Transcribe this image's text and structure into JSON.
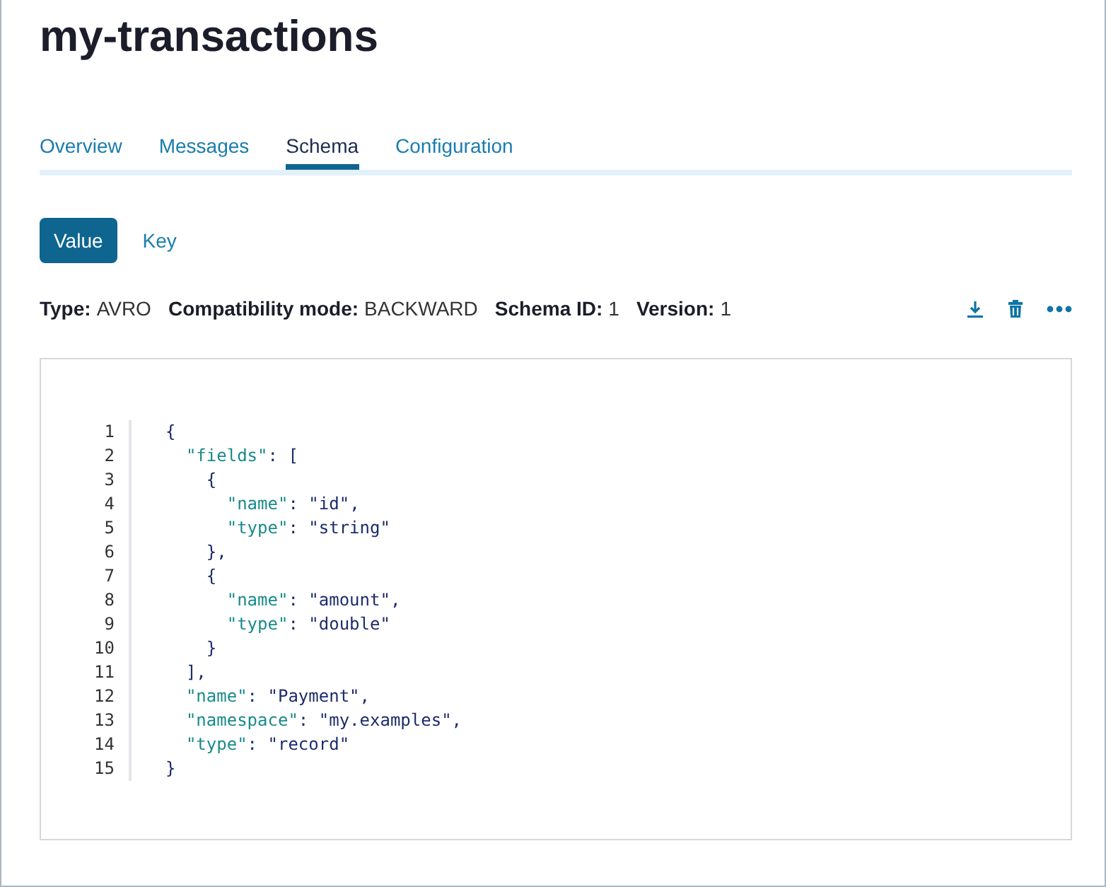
{
  "title": "my-transactions",
  "tabs": [
    {
      "label": "Overview",
      "selected": false
    },
    {
      "label": "Messages",
      "selected": false
    },
    {
      "label": "Schema",
      "selected": true
    },
    {
      "label": "Configuration",
      "selected": false
    }
  ],
  "toggle": [
    {
      "label": "Value",
      "selected": true
    },
    {
      "label": "Key",
      "selected": false
    }
  ],
  "meta": [
    {
      "label": "Type:",
      "value": "AVRO"
    },
    {
      "label": "Compatibility mode:",
      "value": "BACKWARD"
    },
    {
      "label": "Schema ID:",
      "value": "1"
    },
    {
      "label": "Version:",
      "value": "1"
    }
  ],
  "code_lines": [
    {
      "number": "1",
      "tokens": [
        {
          "kind": "punct",
          "text": "{"
        }
      ]
    },
    {
      "number": "2",
      "tokens": [
        {
          "kind": "key",
          "text": "  \"fields\""
        },
        {
          "kind": "punct",
          "text": ": ["
        }
      ]
    },
    {
      "number": "3",
      "tokens": [
        {
          "kind": "punct",
          "text": "    {"
        }
      ]
    },
    {
      "number": "4",
      "tokens": [
        {
          "kind": "key",
          "text": "      \"name\""
        },
        {
          "kind": "punct",
          "text": ": "
        },
        {
          "kind": "string",
          "text": "\"id\""
        },
        {
          "kind": "punct",
          "text": ","
        }
      ]
    },
    {
      "number": "5",
      "tokens": [
        {
          "kind": "key",
          "text": "      \"type\""
        },
        {
          "kind": "punct",
          "text": ": "
        },
        {
          "kind": "string",
          "text": "\"string\""
        }
      ]
    },
    {
      "number": "6",
      "tokens": [
        {
          "kind": "punct",
          "text": "    },"
        }
      ]
    },
    {
      "number": "7",
      "tokens": [
        {
          "kind": "punct",
          "text": "    {"
        }
      ]
    },
    {
      "number": "8",
      "tokens": [
        {
          "kind": "key",
          "text": "      \"name\""
        },
        {
          "kind": "punct",
          "text": ": "
        },
        {
          "kind": "string",
          "text": "\"amount\""
        },
        {
          "kind": "punct",
          "text": ","
        }
      ]
    },
    {
      "number": "9",
      "tokens": [
        {
          "kind": "key",
          "text": "      \"type\""
        },
        {
          "kind": "punct",
          "text": ": "
        },
        {
          "kind": "string",
          "text": "\"double\""
        }
      ]
    },
    {
      "number": "10",
      "tokens": [
        {
          "kind": "punct",
          "text": "    }"
        }
      ]
    },
    {
      "number": "11",
      "tokens": [
        {
          "kind": "punct",
          "text": "  ],"
        }
      ]
    },
    {
      "number": "12",
      "tokens": [
        {
          "kind": "key",
          "text": "  \"name\""
        },
        {
          "kind": "punct",
          "text": ": "
        },
        {
          "kind": "string",
          "text": "\"Payment\""
        },
        {
          "kind": "punct",
          "text": ","
        }
      ]
    },
    {
      "number": "13",
      "tokens": [
        {
          "kind": "key",
          "text": "  \"namespace\""
        },
        {
          "kind": "punct",
          "text": ": "
        },
        {
          "kind": "string",
          "text": "\"my.examples\""
        },
        {
          "kind": "punct",
          "text": ","
        }
      ]
    },
    {
      "number": "14",
      "tokens": [
        {
          "kind": "key",
          "text": "  \"type\""
        },
        {
          "kind": "punct",
          "text": ": "
        },
        {
          "kind": "string",
          "text": "\"record\""
        }
      ]
    },
    {
      "number": "15",
      "tokens": [
        {
          "kind": "punct",
          "text": "}"
        }
      ]
    }
  ]
}
